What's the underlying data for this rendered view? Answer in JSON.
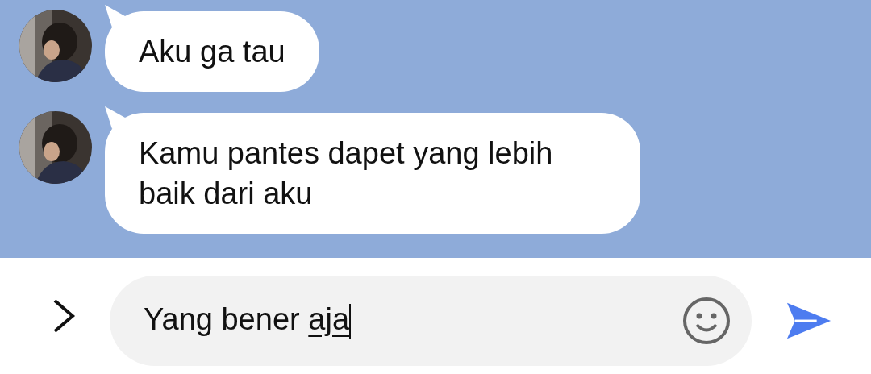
{
  "messages": [
    {
      "text": "Aku ga tau"
    },
    {
      "text": "Kamu pantes dapet yang lebih baik dari aku"
    }
  ],
  "composer": {
    "value_parts": [
      {
        "text": "Yang bener",
        "composing": false
      },
      {
        "text": "aja",
        "composing": true
      }
    ]
  }
}
